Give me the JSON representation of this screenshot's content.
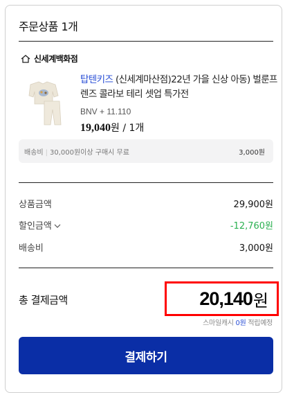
{
  "header": {
    "title": "주문상품 1개"
  },
  "store": {
    "icon": "home-icon",
    "name": "신세계백화점"
  },
  "product": {
    "brand": "탑텐키즈",
    "name_rest": " (신세계마산점)22년 가을 신상 아동) 벌룬프렌즈 콜라보 테리 셋업 특가전",
    "option": "BNV + 11.110",
    "price": "19,040",
    "price_unit": "원",
    "quantity": " / 1개"
  },
  "shipping_box": {
    "label": "배송비",
    "condition": "30,000원이상 구매시 무료",
    "fee": "3,000원"
  },
  "summary": {
    "product_amount_label": "상품금액",
    "product_amount": "29,900원",
    "discount_label": "할인금액",
    "discount": "-12,760원",
    "shipping_label": "배송비",
    "shipping": "3,000원"
  },
  "total": {
    "label": "총 결제금액",
    "amount": "20,140",
    "unit": "원"
  },
  "points": {
    "prefix": "스마일캐시 ",
    "amount": "0원",
    "suffix": " 적립예정"
  },
  "pay_button": {
    "label": "결제하기"
  },
  "colors": {
    "accent_blue": "#0a2ea6",
    "brand_link": "#2a4fd6",
    "discount_green": "#2ab050",
    "highlight_red": "#ff0000"
  }
}
